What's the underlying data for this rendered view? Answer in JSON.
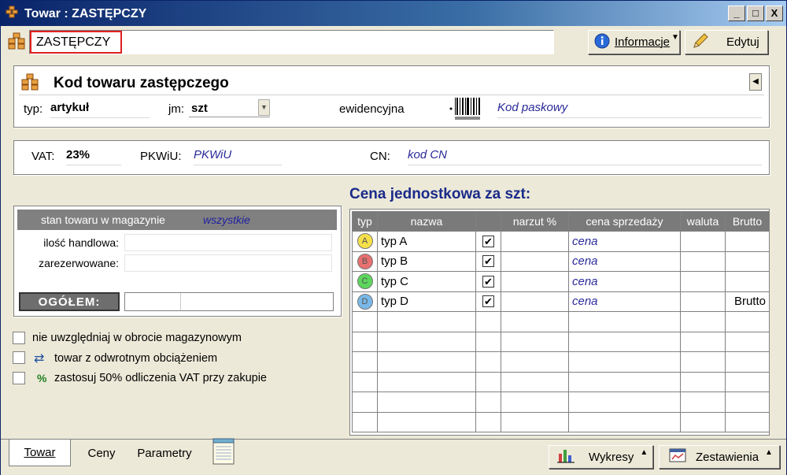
{
  "window": {
    "title": "Towar : ZASTĘPCZY",
    "minimize": "_",
    "maximize": "□",
    "close": "X"
  },
  "header": {
    "name_value": "ZASTĘPCZY",
    "info_button": "Informacje",
    "edit_button": "Edytuj"
  },
  "product": {
    "section_title": "Kod towaru zastępczego",
    "typ_label": "typ:",
    "typ_value": "artykuł",
    "jm_label": "jm:",
    "jm_value": "szt",
    "ewidencyjna_label": "ewidencyjna",
    "barcode_placeholder": "Kod paskowy"
  },
  "tax": {
    "vat_label": "VAT:",
    "vat_value": "23%",
    "pkwiu_label": "PKWiU:",
    "pkwiu_placeholder": "PKWiU",
    "cn_label": "CN:",
    "cn_placeholder": "kod CN"
  },
  "stock": {
    "header_label": "stan towaru w magazynie",
    "header_filter": "wszystkie",
    "qty_label": "ilość handlowa:",
    "reserved_label": "zarezerwowane:",
    "total_label": "OGÓŁEM:"
  },
  "options": [
    {
      "label": "nie uwzględniaj w obrocie magazynowym",
      "icon": ""
    },
    {
      "label": "towar z odwrotnym obciążeniem",
      "icon": "reverse-arrows-icon"
    },
    {
      "label": "zastosuj 50% odliczenia VAT przy zakupie",
      "icon": "percent-icon"
    }
  ],
  "prices": {
    "title": "Cena jednostkowa za szt:",
    "columns": [
      "typ",
      "nazwa",
      "",
      "narzut %",
      "cena sprzedaży",
      "waluta",
      "Brutto"
    ],
    "rows": [
      {
        "badge": "A",
        "badge_color": "#f5e04a",
        "name": "typ A",
        "checked": "✔",
        "price": "cena",
        "brutto": ""
      },
      {
        "badge": "B",
        "badge_color": "#e87070",
        "name": "typ B",
        "checked": "✔",
        "price": "cena",
        "brutto": ""
      },
      {
        "badge": "C",
        "badge_color": "#5cd65c",
        "name": "typ C",
        "checked": "✔",
        "price": "cena",
        "brutto": ""
      },
      {
        "badge": "D",
        "badge_color": "#7ab8e8",
        "name": "typ D",
        "checked": "✔",
        "price": "cena",
        "brutto": "Brutto"
      }
    ],
    "empty_rows": 6
  },
  "tabs": {
    "towar": "Towar",
    "ceny": "Ceny",
    "parametry": "Parametry"
  },
  "bottom_buttons": {
    "wykresy": "Wykresy",
    "zestawienia": "Zestawienia"
  },
  "colors": {
    "title_gradient_start": "#0a246a",
    "accent_blue": "#1a2a8a",
    "highlight_red": "#e02020"
  }
}
